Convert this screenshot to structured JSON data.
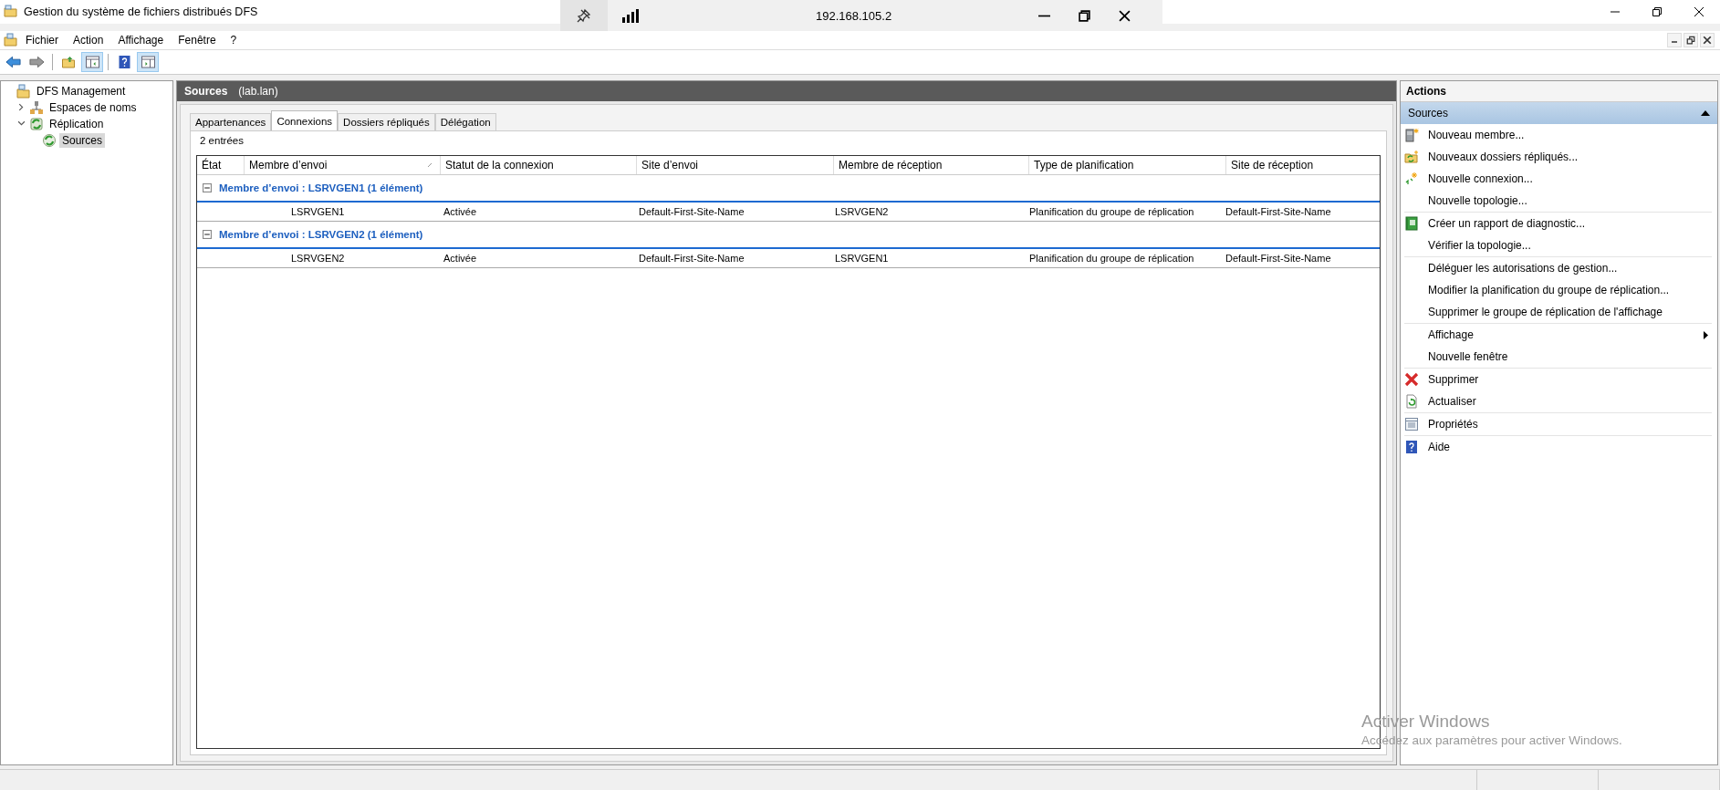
{
  "window": {
    "title": "Gestion du système de fichiers distribués DFS"
  },
  "remote_bar": {
    "address": "192.168.105.2"
  },
  "menu": [
    "Fichier",
    "Action",
    "Affichage",
    "Fenêtre",
    "?"
  ],
  "tree": [
    {
      "label": "DFS Management",
      "kind": "root",
      "selected": false,
      "children": [
        {
          "label": "Espaces de noms",
          "kind": "namespace",
          "expanded": false,
          "selected": false
        },
        {
          "label": "Réplication",
          "kind": "replication",
          "expanded": true,
          "selected": false,
          "children": [
            {
              "label": "Sources",
              "kind": "group",
              "selected": true
            }
          ]
        }
      ]
    }
  ],
  "content": {
    "title": "Sources",
    "subtitle": "(lab.lan)",
    "tabs": [
      {
        "label": "Appartenances",
        "selected": false
      },
      {
        "label": "Connexions",
        "selected": true
      },
      {
        "label": "Dossiers répliqués",
        "selected": false
      },
      {
        "label": "Délégation",
        "selected": false
      }
    ],
    "count": "2 entrées",
    "table": {
      "columns": [
        {
          "label": "État",
          "sorted": false
        },
        {
          "label": "Membre d’envoi",
          "sorted": true
        },
        {
          "label": "Statut de la connexion",
          "sorted": false
        },
        {
          "label": "Site d’envoi",
          "sorted": false
        },
        {
          "label": "Membre de réception",
          "sorted": false
        },
        {
          "label": "Type de planification",
          "sorted": false
        },
        {
          "label": "Site de réception",
          "sorted": false
        }
      ],
      "groups": [
        {
          "label": "Membre d’envoi : LSRVGEN1 (1 élément)",
          "expanded": true,
          "rows": [
            [
              "",
              "LSRVGEN1",
              "Activée",
              "Default-First-Site-Name",
              "LSRVGEN2",
              "Planification du groupe de réplication",
              "Default-First-Site-Name"
            ]
          ]
        },
        {
          "label": "Membre d’envoi : LSRVGEN2 (1 élément)",
          "expanded": true,
          "rows": [
            [
              "",
              "LSRVGEN2",
              "Activée",
              "Default-First-Site-Name",
              "LSRVGEN1",
              "Planification du groupe de réplication",
              "Default-First-Site-Name"
            ]
          ]
        }
      ]
    }
  },
  "actions": {
    "title": "Actions",
    "section": "Sources",
    "groups": [
      [
        {
          "label": "Nouveau membre...",
          "kind": "member"
        },
        {
          "label": "Nouveaux dossiers répliqués...",
          "kind": "folders"
        },
        {
          "label": "Nouvelle connexion...",
          "kind": "connection"
        },
        {
          "label": "Nouvelle topologie...",
          "kind": "none"
        }
      ],
      [
        {
          "label": "Créer un rapport de diagnostic...",
          "kind": "report"
        },
        {
          "label": "Vérifier la topologie...",
          "kind": "none"
        }
      ],
      [
        {
          "label": "Déléguer les autorisations de gestion...",
          "kind": "none"
        },
        {
          "label": "Modifier la planification du groupe de réplication...",
          "kind": "none"
        },
        {
          "label": "Supprimer le groupe de réplication de l'affichage",
          "kind": "none"
        }
      ],
      [
        {
          "label": "Affichage",
          "kind": "none",
          "submenu": true
        },
        {
          "label": "Nouvelle fenêtre",
          "kind": "none"
        }
      ],
      [
        {
          "label": "Supprimer",
          "kind": "delete"
        },
        {
          "label": "Actualiser",
          "kind": "refresh"
        }
      ],
      [
        {
          "label": "Propriétés",
          "kind": "properties"
        }
      ],
      [
        {
          "label": "Aide",
          "kind": "help"
        }
      ]
    ]
  },
  "activation_notice": {
    "title": "Activer Windows",
    "text": "Accédez aux paramètres pour activer Windows."
  }
}
